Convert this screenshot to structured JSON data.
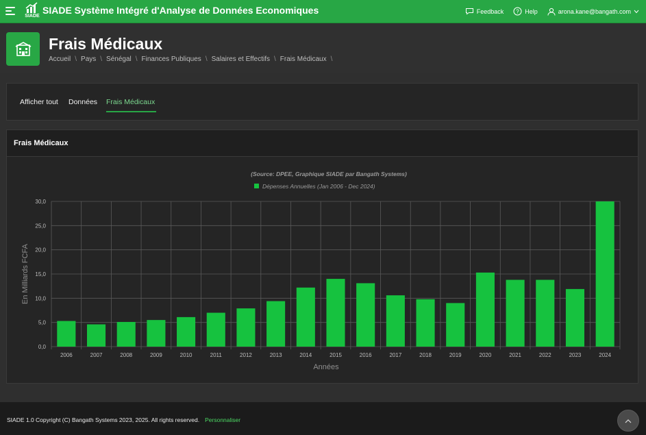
{
  "app": {
    "title": "SIADE Système Intégré d'Analyse de Données Economiques",
    "logo_text": "SIADE",
    "logo_icon": "bar-chart-growth-icon"
  },
  "topnav": {
    "feedback_label": "Feedback",
    "help_label": "Help",
    "user_email": "arona.kane@bangath.com"
  },
  "page": {
    "title": "Frais Médicaux",
    "icon": "hospital-icon",
    "breadcrumb": [
      "Accueil",
      "Pays",
      "Sénégal",
      "Finances Publiques",
      "Salaires et Effectifs",
      "Frais Médicaux"
    ]
  },
  "tabs": [
    {
      "label": "Afficher tout",
      "active": false
    },
    {
      "label": "Données",
      "active": false
    },
    {
      "label": "Frais Médicaux",
      "active": true
    }
  ],
  "chart_card": {
    "title": "Frais Médicaux"
  },
  "chart_data": {
    "type": "bar",
    "subtitle": "(Source: DPEE, Graphique SIADE par Bangath Systems)",
    "series": [
      {
        "name": "Dépenses Annuelles (Jan 2006 - Dec 2024)",
        "color": "#16c23f",
        "values": [
          5.3,
          4.6,
          5.1,
          5.5,
          6.1,
          7.0,
          7.9,
          9.4,
          12.2,
          14.0,
          13.1,
          10.6,
          9.8,
          9.0,
          15.3,
          13.8,
          13.8,
          11.9,
          30.0
        ]
      }
    ],
    "categories": [
      "2006",
      "2007",
      "2008",
      "2009",
      "2010",
      "2011",
      "2012",
      "2013",
      "2014",
      "2015",
      "2016",
      "2017",
      "2018",
      "2019",
      "2020",
      "2021",
      "2022",
      "2023",
      "2024"
    ],
    "xlabel": "Années",
    "ylabel": "En Milliards FCFA",
    "ylim": [
      0,
      30
    ],
    "yticks": [
      "0,0",
      "5,0",
      "10,0",
      "15,0",
      "20,0",
      "25,0",
      "30,0"
    ],
    "grid": true,
    "legend_position": "top-center"
  },
  "footer": {
    "copyright": "SIADE 1.0 Copyright (C) Bangath Systems 2023, 2025. All rights reserved.",
    "customize_label": "Personnaliser"
  },
  "colors": {
    "accent": "#28a745",
    "bar": "#16c23f",
    "background": "#2f2f2f"
  }
}
